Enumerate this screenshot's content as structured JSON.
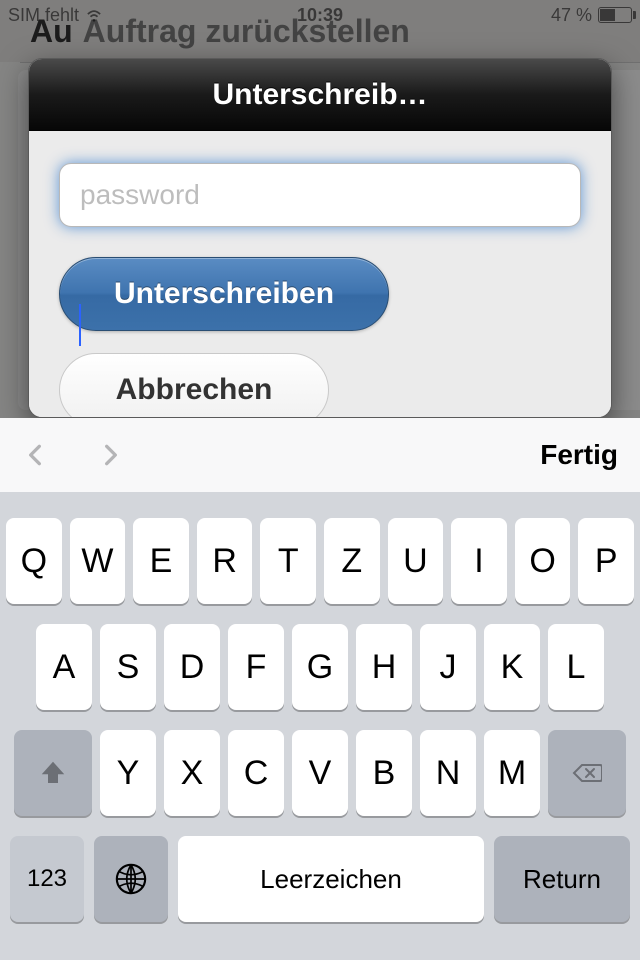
{
  "status": {
    "sim": "SIM fehlt",
    "time": "10:39",
    "battery_pct": "47 %"
  },
  "background": {
    "title_prefix": "Au",
    "title_rest": "Auftrag zurückstellen"
  },
  "modal": {
    "title": "Unterschreib…",
    "password_placeholder": "password",
    "password_value": "",
    "sign_label": "Unterschreiben",
    "cancel_label": "Abbrechen"
  },
  "accessory": {
    "done": "Fertig"
  },
  "keyboard": {
    "row1": [
      "Q",
      "W",
      "E",
      "R",
      "T",
      "Z",
      "U",
      "I",
      "O",
      "P"
    ],
    "row2": [
      "A",
      "S",
      "D",
      "F",
      "G",
      "H",
      "J",
      "K",
      "L"
    ],
    "row3": [
      "Y",
      "X",
      "C",
      "V",
      "B",
      "N",
      "M"
    ],
    "numbers_label": "123",
    "space_label": "Leerzeichen",
    "return_label": "Return"
  }
}
